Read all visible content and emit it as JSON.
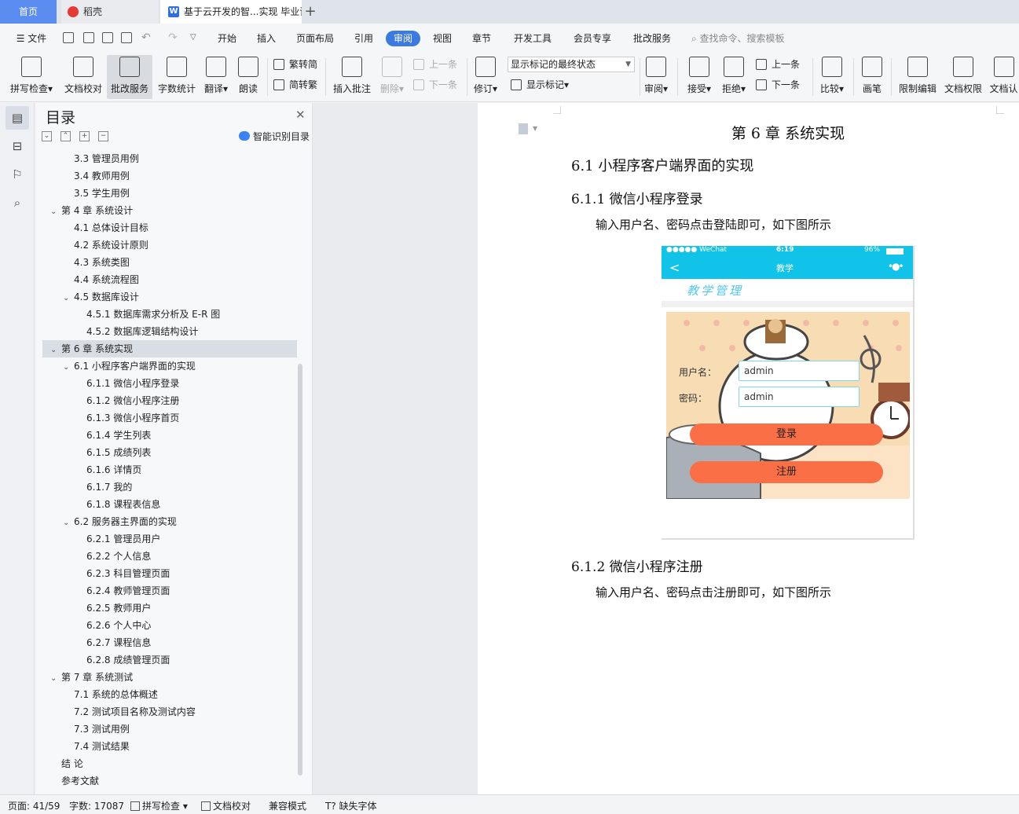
{
  "tabs": {
    "home": "首页",
    "daoke": "稻壳",
    "doc": "基于云开发的智...实现 毕业论",
    "add": "+"
  },
  "menu": {
    "file": "文件",
    "items": [
      "开始",
      "插入",
      "页面布局",
      "引用",
      "审阅",
      "视图",
      "章节",
      "开发工具",
      "会员专享",
      "批改服务"
    ],
    "active": "审阅",
    "search": "查找命令、搜索模板"
  },
  "ribbon": {
    "spell": "拼写检查",
    "proof": "文档校对",
    "correct": "批改服务",
    "wordcount": "字数统计",
    "translate": "翻译",
    "read": "朗读",
    "trad": "繁转简",
    "simp": "简转繁",
    "insert_comment": "插入批注",
    "delete": "删除",
    "prev_comment": "上一条",
    "next_comment": "下一条",
    "revise": "修订",
    "markup_state": "显示标记的最终状态",
    "show_markup": "显示标记",
    "review": "审阅",
    "accept": "接受",
    "reject": "拒绝",
    "prev": "上一条",
    "next": "下一条",
    "compare": "比较",
    "pen": "画笔",
    "restrict": "限制编辑",
    "permission": "文档权限",
    "cert": "文档认"
  },
  "toc": {
    "title": "目录",
    "smart": "智能识别目录",
    "items": [
      {
        "text": "3.3 管理员用例",
        "level": 2
      },
      {
        "text": "3.4 教师用例",
        "level": 2
      },
      {
        "text": "3.5 学生用例",
        "level": 2
      },
      {
        "text": "第 4 章  系统设计",
        "level": 1,
        "caret": true
      },
      {
        "text": "4.1 总体设计目标",
        "level": 2
      },
      {
        "text": "4.2 系统设计原则",
        "level": 2
      },
      {
        "text": "4.3 系统类图",
        "level": 2
      },
      {
        "text": "4.4 系统流程图",
        "level": 2
      },
      {
        "text": "4.5 数据库设计",
        "level": 2,
        "caret": true
      },
      {
        "text": "4.5.1 数据库需求分析及 E-R 图",
        "level": 3
      },
      {
        "text": "4.5.2  数据库逻辑结构设计",
        "level": 3
      },
      {
        "text": "第 6 章  系统实现",
        "level": 1,
        "caret": true,
        "selected": true
      },
      {
        "text": "6.1  小程序客户端界面的实现",
        "level": 2,
        "caret": true
      },
      {
        "text": "6.1.1  微信小程序登录",
        "level": 3
      },
      {
        "text": "6.1.2 微信小程序注册",
        "level": 3
      },
      {
        "text": "6.1.3 微信小程序首页",
        "level": 3
      },
      {
        "text": "6.1.4 学生列表",
        "level": 3
      },
      {
        "text": "6.1.5 成绩列表",
        "level": 3
      },
      {
        "text": "6.1.6 详情页",
        "level": 3
      },
      {
        "text": "6.1.7 我的",
        "level": 3
      },
      {
        "text": "6.1.8 课程表信息",
        "level": 3
      },
      {
        "text": "6.2  服务器主界面的实现",
        "level": 2,
        "caret": true
      },
      {
        "text": "6.2.1 管理员用户",
        "level": 3
      },
      {
        "text": "6.2.2 个人信息",
        "level": 3
      },
      {
        "text": "6.2.3 科目管理页面",
        "level": 3
      },
      {
        "text": "6.2.4 教师管理页面",
        "level": 3
      },
      {
        "text": "6.2.5 教师用户",
        "level": 3
      },
      {
        "text": "6.2.6 个人中心",
        "level": 3
      },
      {
        "text": "6.2.7 课程信息",
        "level": 3
      },
      {
        "text": "6.2.8 成绩管理页面",
        "level": 3
      },
      {
        "text": "第 7 章  系统测试",
        "level": 1,
        "caret": true
      },
      {
        "text": "7.1 系统的总体概述",
        "level": 2
      },
      {
        "text": "7.2 测试项目名称及测试内容",
        "level": 2
      },
      {
        "text": "7.3 测试用例",
        "level": 2
      },
      {
        "text": "7.4 测试结果",
        "level": 2
      },
      {
        "text": "结    论",
        "level": 1
      },
      {
        "text": "参考文献",
        "level": 1
      }
    ]
  },
  "document": {
    "chapter_title": "第 6 章  系统实现",
    "h_6_1": "6.1  小程序客户端界面的实现",
    "h_6_1_1": "6.1.1  微信小程序登录",
    "p1": "输入用户名、密码点击登陆即可，如下图所示",
    "h_6_1_2": "6.1.2 微信小程序注册",
    "p2": "输入用户名、密码点击注册即可，如下图所示"
  },
  "phone": {
    "carrier": "●●●●● WeChat",
    "time": "6:19",
    "battery": "96%",
    "back": "<",
    "nav_title": "教学",
    "brand": "教学管理",
    "username_label": "用户名：",
    "username_value": "admin",
    "password_label": "密码：",
    "password_value": "admin",
    "login_button": "登录",
    "register_button": "注册"
  },
  "status": {
    "page": "页面: 41/59",
    "words": "字数: 17087",
    "spell": "拼写检查",
    "proof": "文档校对",
    "compat": "兼容模式",
    "font_missing": "缺失字体"
  },
  "colors": {
    "accent": "#3b7ae0",
    "phone_bar": "#11c3e8",
    "phone_button": "#fb6f46",
    "phone_bg": "#f8dcb4"
  }
}
